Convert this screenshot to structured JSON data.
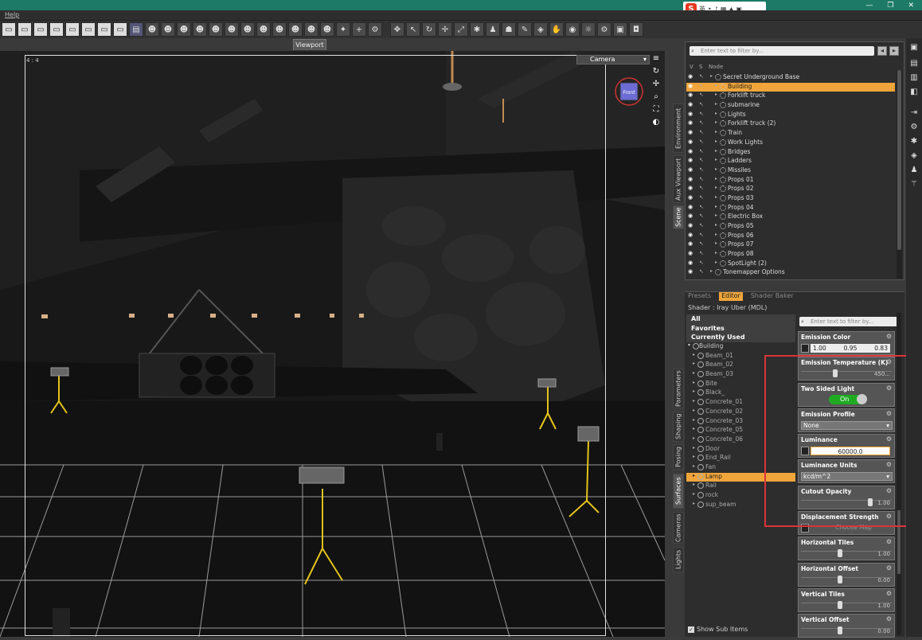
{
  "menubar": {
    "help": "Help"
  },
  "ime": {
    "logo": "S",
    "lang": "英"
  },
  "viewport": {
    "tab": "Viewport",
    "ratio": "4 : 4",
    "camera": "Camera",
    "navcube_label": "Front"
  },
  "scene": {
    "filter_placeholder": "Enter text to filter by...",
    "col_v": "V",
    "col_s": "S",
    "col_node": "Node",
    "nodes": [
      {
        "label": "Secret Underground Base",
        "depth": 0,
        "selected": false
      },
      {
        "label": "Building",
        "depth": 1,
        "selected": true
      },
      {
        "label": "Forklift truck",
        "depth": 1,
        "selected": false
      },
      {
        "label": "submarine",
        "depth": 1,
        "selected": false
      },
      {
        "label": "Lights",
        "depth": 1,
        "selected": false
      },
      {
        "label": "Forklift truck (2)",
        "depth": 1,
        "selected": false
      },
      {
        "label": "Train",
        "depth": 1,
        "selected": false
      },
      {
        "label": "Work Lights",
        "depth": 1,
        "selected": false
      },
      {
        "label": "Bridges",
        "depth": 1,
        "selected": false
      },
      {
        "label": "Ladders",
        "depth": 1,
        "selected": false
      },
      {
        "label": "Missiles",
        "depth": 1,
        "selected": false
      },
      {
        "label": "Props 01",
        "depth": 1,
        "selected": false
      },
      {
        "label": "Props 02",
        "depth": 1,
        "selected": false
      },
      {
        "label": "Props 03",
        "depth": 1,
        "selected": false
      },
      {
        "label": "Props 04",
        "depth": 1,
        "selected": false
      },
      {
        "label": "Electric Box",
        "depth": 1,
        "selected": false
      },
      {
        "label": "Props 05",
        "depth": 1,
        "selected": false
      },
      {
        "label": "Props 06",
        "depth": 1,
        "selected": false
      },
      {
        "label": "Props 07",
        "depth": 1,
        "selected": false
      },
      {
        "label": "Props 08",
        "depth": 1,
        "selected": false
      },
      {
        "label": "SpotLight (2)",
        "depth": 1,
        "selected": false
      },
      {
        "label": "Tonemapper Options",
        "depth": 0,
        "selected": false
      }
    ]
  },
  "side_tabs": {
    "environment": "Environment",
    "aux": "Aux Viewport",
    "scene": "Scene",
    "parameters": "Parameters",
    "shaping": "Shaping",
    "posing": "Posing",
    "surfaces": "Surfaces",
    "cameras": "Cameras",
    "lights": "Lights"
  },
  "surfaces": {
    "tabs": {
      "presets": "Presets",
      "editor": "Editor",
      "baker": "Shader Baker"
    },
    "shader": "Shader : Iray Uber (MDL)",
    "categories": [
      "All",
      "Favorites",
      "Currently Used"
    ],
    "root": "Building",
    "materials": [
      {
        "label": "Beam_01",
        "selected": false
      },
      {
        "label": "Beam_02",
        "selected": false
      },
      {
        "label": "Beam_03",
        "selected": false
      },
      {
        "label": "Bite",
        "selected": false
      },
      {
        "label": "Black_",
        "selected": false
      },
      {
        "label": "Concrete_01",
        "selected": false
      },
      {
        "label": "Concrete_02",
        "selected": false
      },
      {
        "label": "Concrete_03",
        "selected": false
      },
      {
        "label": "Concrete_05",
        "selected": false
      },
      {
        "label": "Concrete_06",
        "selected": false
      },
      {
        "label": "Door",
        "selected": false
      },
      {
        "label": "End_Rail",
        "selected": false
      },
      {
        "label": "Fan",
        "selected": false
      },
      {
        "label": "Lamp",
        "selected": true
      },
      {
        "label": "Rail",
        "selected": false
      },
      {
        "label": "rock",
        "selected": false
      },
      {
        "label": "sup_beam",
        "selected": false
      }
    ],
    "show_sub": "Show Sub Items",
    "filter_placeholder": "Enter text to filter by...",
    "props": {
      "emission_color": {
        "title": "Emission Color",
        "r": "1.00",
        "g": "0.95",
        "b": "0.83"
      },
      "emission_temp": {
        "title": "Emission Temperature (K)",
        "value": "450...",
        "level": 0.35
      },
      "two_sided": {
        "title": "Two Sided Light",
        "value": "On"
      },
      "emission_profile": {
        "title": "Emission Profile",
        "value": "None"
      },
      "luminance": {
        "title": "Luminance",
        "value": "60000.0"
      },
      "lum_units": {
        "title": "Luminance Units",
        "value": "kcd/m^2"
      },
      "cutout": {
        "title": "Cutout Opacity",
        "value": "1.00",
        "level": 0.74
      },
      "displacement": {
        "title": "Displacement Strength",
        "value": "Choose Map"
      },
      "htiles": {
        "title": "Horizontal Tiles",
        "value": "1.00",
        "level": 0.4
      },
      "hoffset": {
        "title": "Horizontal Offset",
        "value": "0.00",
        "level": 0.4
      },
      "vtiles": {
        "title": "Vertical Tiles",
        "value": "1.00",
        "level": 0.4
      },
      "voffset": {
        "title": "Vertical Offset",
        "value": "0.00",
        "level": 0.4
      }
    }
  },
  "colors": {
    "accent": "#f0a53a",
    "titlebar": "#1d7a66",
    "toggle_on": "#1faa22",
    "highlight": "#d9343a"
  }
}
